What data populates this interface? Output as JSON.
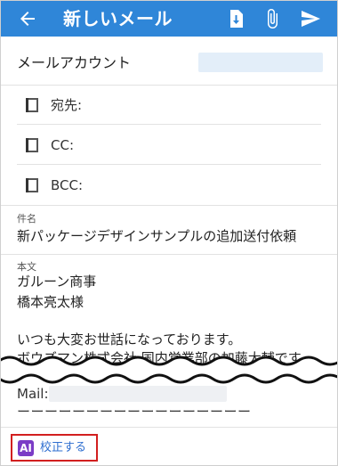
{
  "header": {
    "title": "新しいメール",
    "bg_color": "#2f86d8",
    "icons": [
      "back-arrow-icon",
      "save-draft-icon",
      "attachment-icon",
      "send-icon"
    ]
  },
  "account": {
    "label": "メールアカウント"
  },
  "recipients": {
    "to_label": "宛先:",
    "cc_label": "CC:",
    "bcc_label": "BCC:"
  },
  "subject": {
    "caption": "件名",
    "value": "新パッケージデザインサンプルの追加送付依頼"
  },
  "body": {
    "caption": "本文",
    "line1": "ガルーン商事",
    "line2": "橋本亮太様",
    "line3": "いつも大変お世話になっております。",
    "line4": "ボウズマン株式会社 国内営業部の加藤大輔です。",
    "mail_label": "Mail:",
    "dashes": "ーーーーーーーーーーーーーーーーー"
  },
  "footer": {
    "ai_badge": "AI",
    "proofread_label": "校正する",
    "highlight_color": "#d21f1f"
  }
}
